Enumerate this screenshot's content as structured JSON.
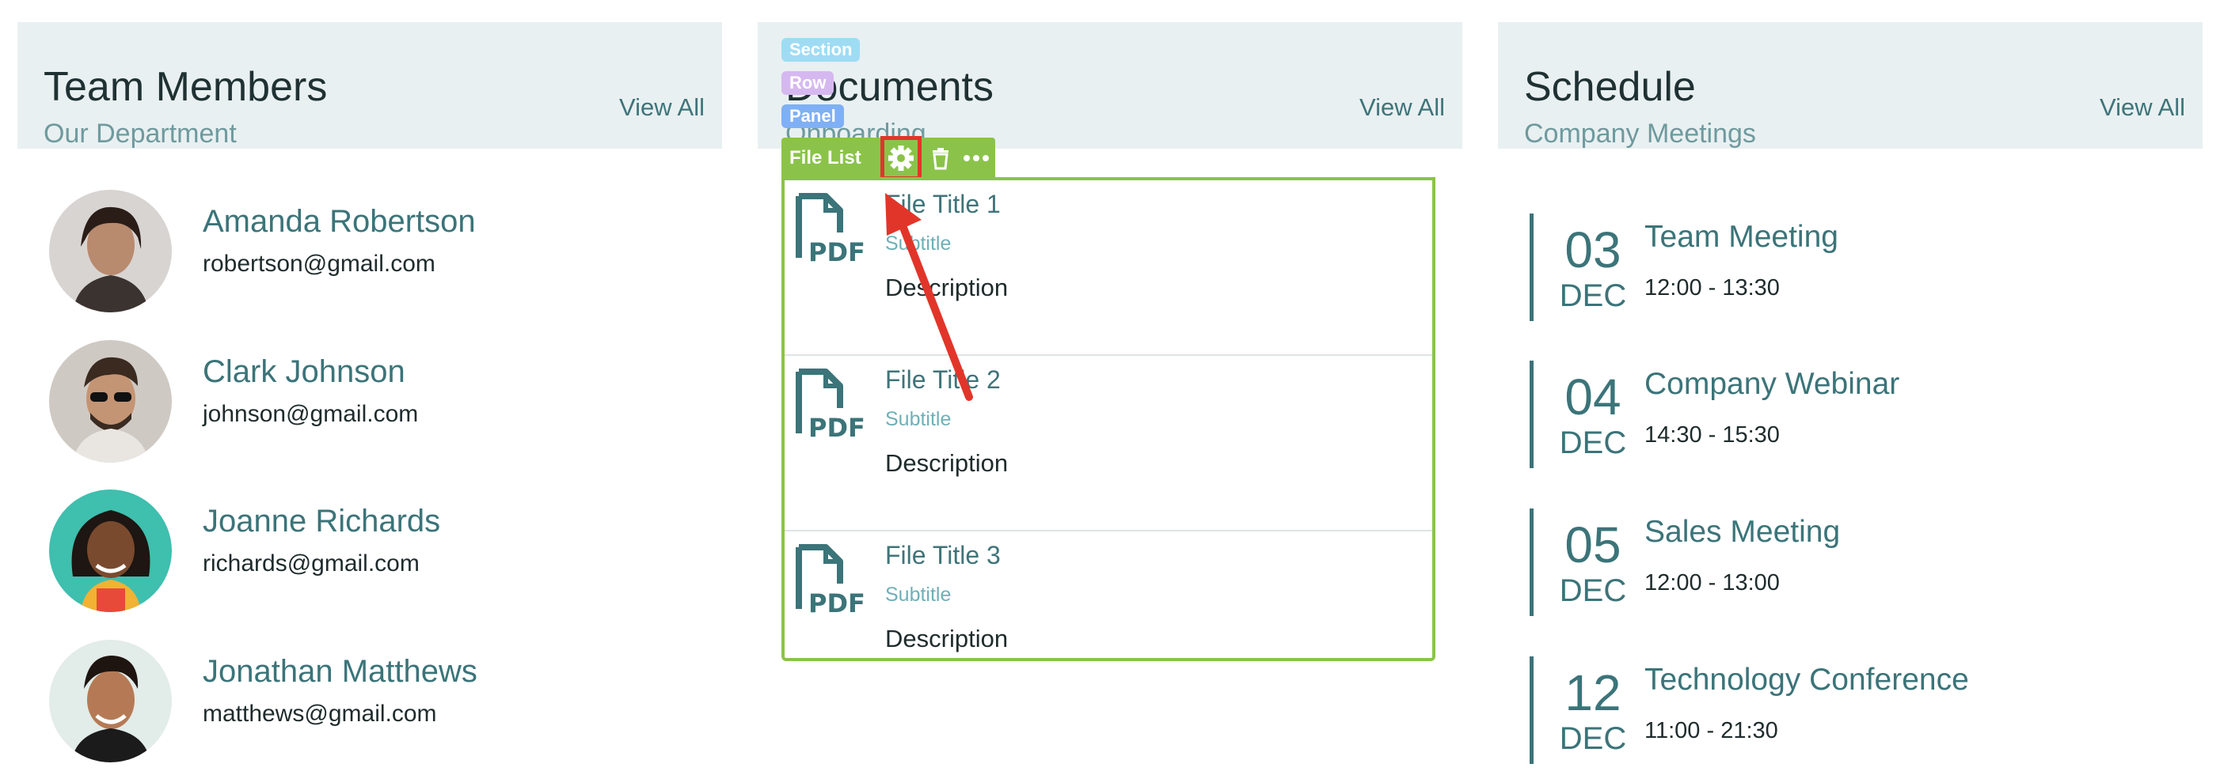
{
  "team_panel": {
    "title": "Team Members",
    "subtitle": "Our Department",
    "view_all": "View All",
    "members": [
      {
        "name": "Amanda Robertson",
        "email": "robertson@gmail.com"
      },
      {
        "name": "Clark Johnson",
        "email": "johnson@gmail.com"
      },
      {
        "name": "Joanne Richards",
        "email": "richards@gmail.com"
      },
      {
        "name": "Jonathan Matthews",
        "email": "matthews@gmail.com"
      }
    ]
  },
  "documents_panel": {
    "title": "Documents",
    "subtitle": "Onboarding",
    "view_all": "View All",
    "builder_tags": {
      "section": "Section",
      "row": "Row",
      "panel": "Panel"
    },
    "toolbar": {
      "label": "File List",
      "icons": [
        "gear-icon",
        "trash-icon",
        "more-icon"
      ]
    },
    "files": [
      {
        "title": "File Title 1",
        "subtitle": "Subtitle",
        "description": "Description",
        "icon": "pdf-file-icon"
      },
      {
        "title": "File Title 2",
        "subtitle": "Subtitle",
        "description": "Description",
        "icon": "pdf-file-icon"
      },
      {
        "title": "File Title 3",
        "subtitle": "Subtitle",
        "description": "Description",
        "icon": "pdf-file-icon"
      }
    ],
    "pdf_glyph": "PDF"
  },
  "schedule_panel": {
    "title": "Schedule",
    "subtitle": "Company Meetings",
    "view_all": "View All",
    "events": [
      {
        "day": "03",
        "month": "DEC",
        "title": "Team Meeting",
        "time": "12:00 - 13:30"
      },
      {
        "day": "04",
        "month": "DEC",
        "title": "Company Webinar",
        "time": "14:30 - 15:30"
      },
      {
        "day": "05",
        "month": "DEC",
        "title": "Sales Meeting",
        "time": "12:00 - 13:00"
      },
      {
        "day": "12",
        "month": "DEC",
        "title": "Technology Conference",
        "time": "11:00 - 21:30"
      }
    ]
  },
  "colors": {
    "accent": "#3b7479",
    "header_bg": "#e9f0f1",
    "builder_green": "#8bc34a",
    "highlight_red": "#e2352a",
    "tag_section": "#9fdcf3",
    "tag_row": "#d6b8f0",
    "tag_panel": "#7fb0f5"
  }
}
